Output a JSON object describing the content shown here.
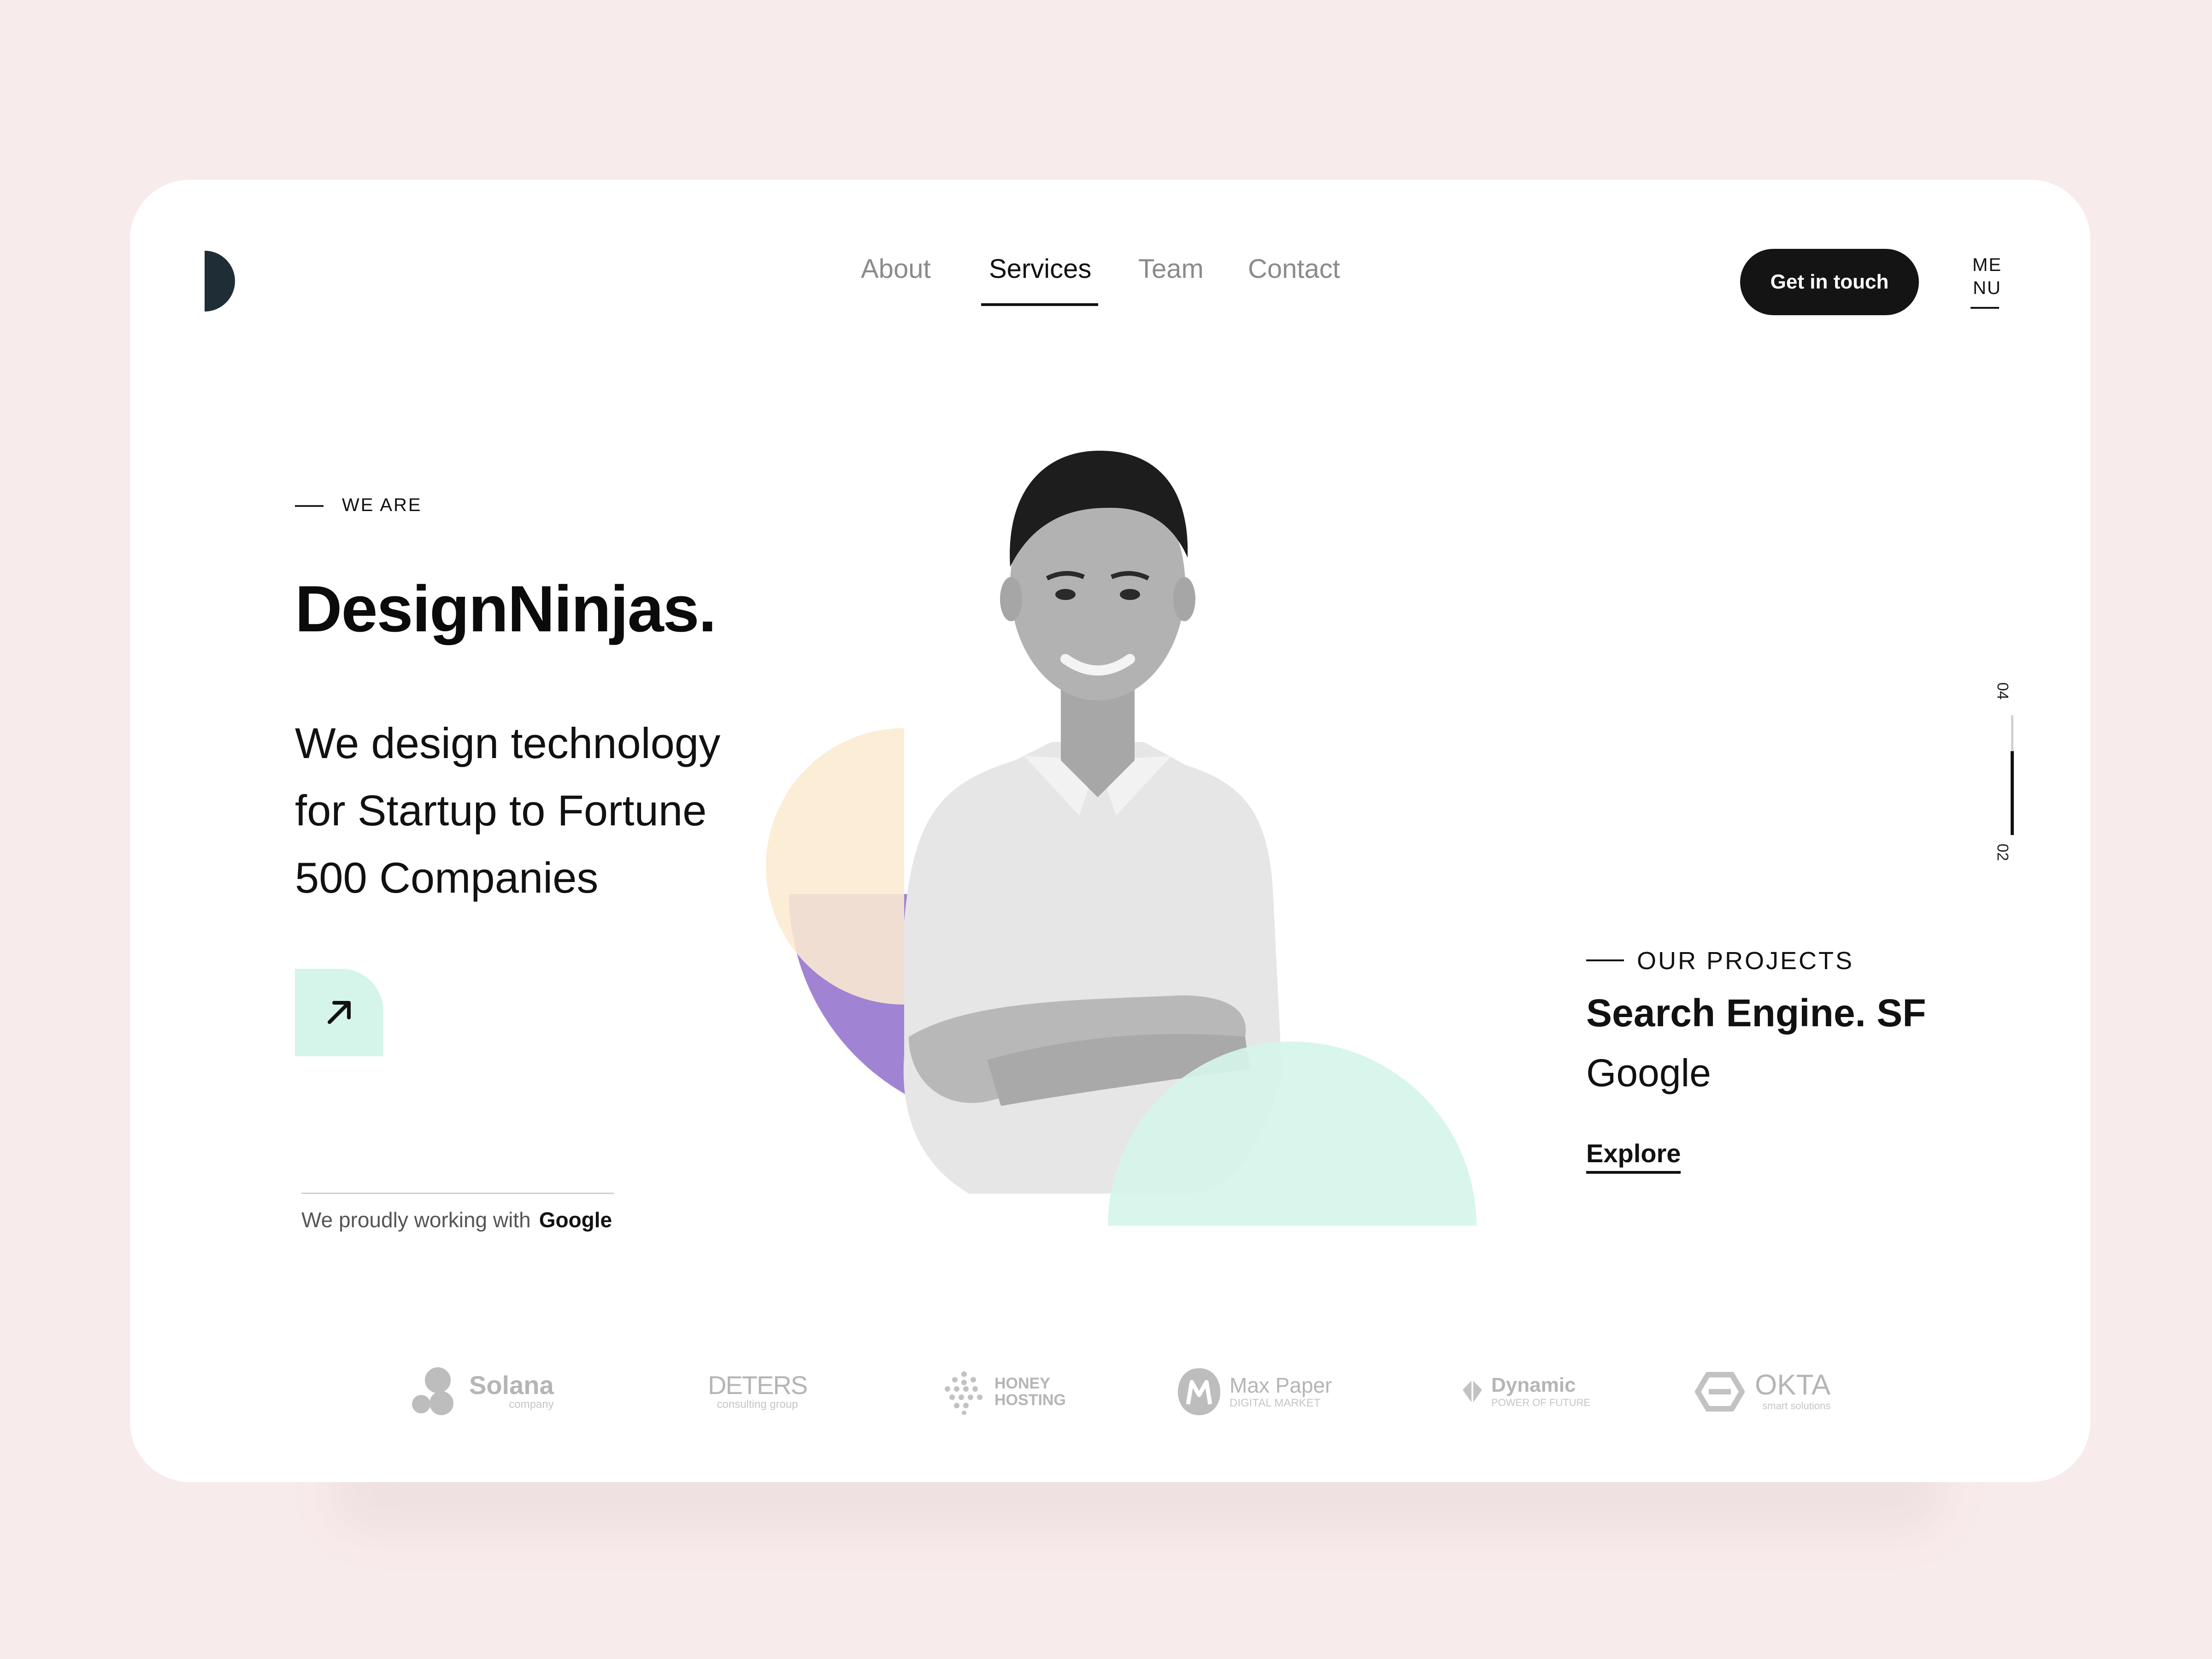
{
  "nav": {
    "items": [
      {
        "label": "About"
      },
      {
        "label": "Services"
      },
      {
        "label": "Team"
      },
      {
        "label": "Contact"
      }
    ],
    "active": "Services",
    "cta_label": "Get in touch",
    "menu_line1": "ME",
    "menu_line2": "NU"
  },
  "hero": {
    "eyebrow": "WE ARE",
    "brand": "DesignNinjas.",
    "tagline": "We design technology for Startup to Fortune 500 Companies",
    "cta_icon": "arrow-up-right-icon",
    "partner_prefix": "We proudly working with",
    "partner_name": "Google"
  },
  "slider": {
    "total": "04",
    "current": "02",
    "progress_fraction": 0.5
  },
  "project": {
    "eyebrow": "OUR PROJECTS",
    "title": "Search Engine. SF",
    "client": "Google",
    "link": "Explore"
  },
  "clients": [
    {
      "name": "Solana",
      "sub": "company",
      "icon": "solana-logo"
    },
    {
      "name": "DETERS",
      "sub": "consulting group",
      "icon": "deters-logo"
    },
    {
      "name": "HONEY",
      "sub": "HOSTING",
      "icon": "honey-dots-logo"
    },
    {
      "name": "Max Paper",
      "sub": "DIGITAL MARKET",
      "icon": "m-logo"
    },
    {
      "name": "Dynamic",
      "sub": "POWER OF FUTURE",
      "icon": "diamond-logo"
    },
    {
      "name": "OKTA",
      "sub": "smart solutions",
      "icon": "s-hex-logo"
    }
  ],
  "colors": {
    "background": "#f8ebeb",
    "card": "#ffffff",
    "dark": "#141414",
    "purple": "#a083d2",
    "cream": "#fcebd2",
    "mint": "#d6f5ea"
  }
}
